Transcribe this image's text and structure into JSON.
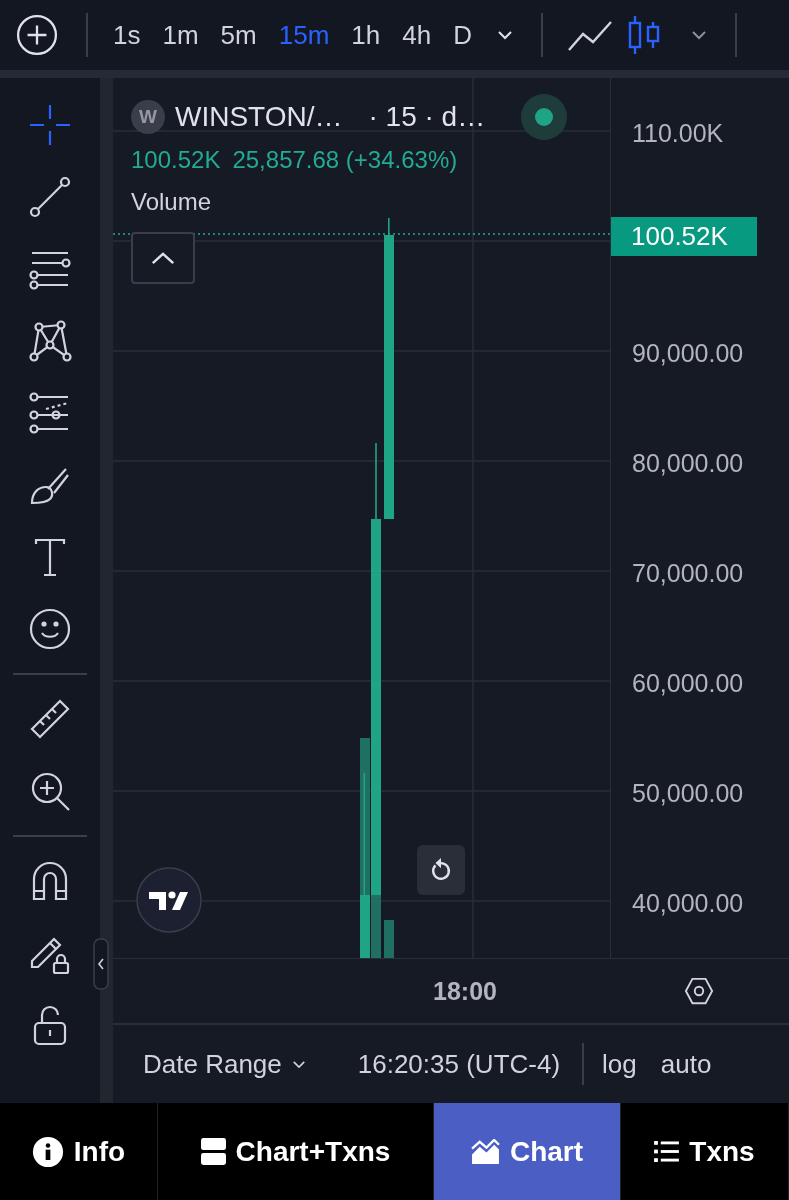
{
  "toolbar": {
    "timeframes": [
      {
        "label": "1s",
        "selected": false
      },
      {
        "label": "1m",
        "selected": false
      },
      {
        "label": "5m",
        "selected": false
      },
      {
        "label": "15m",
        "selected": true
      },
      {
        "label": "1h",
        "selected": false
      },
      {
        "label": "4h",
        "selected": false
      },
      {
        "label": "D",
        "selected": false
      }
    ],
    "chart_types": [
      {
        "kind": "line",
        "selected": false
      },
      {
        "kind": "candles",
        "selected": true
      }
    ]
  },
  "tool_groups": [
    [
      {
        "kind": "crosshair",
        "selected": true
      },
      {
        "kind": "trend-line",
        "selected": false
      },
      {
        "kind": "fib",
        "selected": false
      },
      {
        "kind": "pattern",
        "selected": false
      },
      {
        "kind": "forecast",
        "selected": false
      },
      {
        "kind": "brush",
        "selected": false
      },
      {
        "kind": "text",
        "selected": false
      },
      {
        "kind": "emoji",
        "selected": false
      }
    ],
    [
      {
        "kind": "ruler",
        "selected": false
      },
      {
        "kind": "zoom",
        "selected": false
      }
    ],
    [
      {
        "kind": "magnet",
        "selected": false
      },
      {
        "kind": "draw-lock",
        "selected": false
      },
      {
        "kind": "lock",
        "selected": false
      }
    ]
  ],
  "legend": {
    "avatar": "W",
    "symbol": "WINSTON/…",
    "interval": "· 15 · d…",
    "live": true,
    "price": "100.52K",
    "change": "25,857.68 (+34.63%)",
    "indicator": "Volume"
  },
  "price_axis": {
    "labels": [
      "110.00K",
      "90,000.00",
      "80,000.00",
      "70,000.00",
      "60,000.00",
      "50,000.00",
      "40,000.00"
    ],
    "last_price": "100.52K"
  },
  "time_axis": {
    "labels": [
      "18:00"
    ]
  },
  "footer": {
    "date_range": "Date Range",
    "clock": "16:20:35 (UTC-4)",
    "options": [
      "log",
      "auto"
    ]
  },
  "tabs": [
    {
      "kind": "info",
      "label": "Info",
      "selected": false
    },
    {
      "kind": "split",
      "label": "Chart+Txns",
      "selected": false
    },
    {
      "kind": "chart",
      "label": "Chart",
      "selected": true
    },
    {
      "kind": "list",
      "label": "Txns",
      "selected": false
    }
  ]
}
